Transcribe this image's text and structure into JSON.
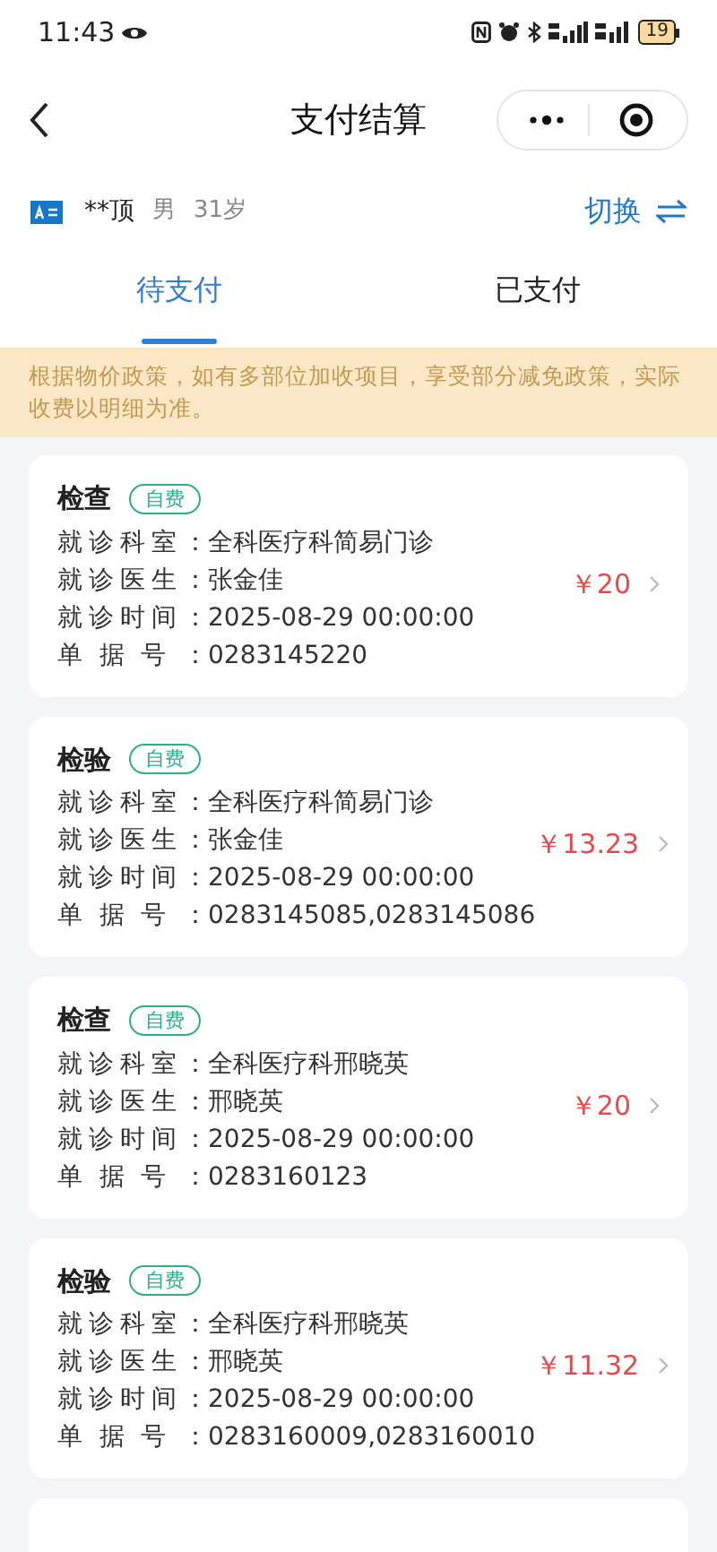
{
  "status_bar": {
    "time": "11:43",
    "battery": "19"
  },
  "nav": {
    "title": "支付结算"
  },
  "patient": {
    "name": "**顶",
    "gender": "男",
    "age": "31岁",
    "switch_label": "切换"
  },
  "tabs": [
    {
      "label": "待支付",
      "selected": true
    },
    {
      "label": "已支付",
      "selected": false
    }
  ],
  "notice": "根据物价政策，如有多部位加收项目，享受部分减免政策，实际收费以明细为准。",
  "bills": [
    {
      "type": "检查",
      "tag": "自费",
      "fields": [
        {
          "label": "就诊科室：",
          "value": "全科医疗科简易门诊"
        },
        {
          "label": "就诊医生：",
          "value": "张金佳"
        },
        {
          "label": "就诊时间：",
          "value": "2025-08-29 00:00:00"
        },
        {
          "label": "单据号：",
          "value": "0283145220"
        }
      ],
      "amount": "￥20"
    },
    {
      "type": "检验",
      "tag": "自费",
      "fields": [
        {
          "label": "就诊科室：",
          "value": "全科医疗科简易门诊"
        },
        {
          "label": "就诊医生：",
          "value": "张金佳"
        },
        {
          "label": "就诊时间：",
          "value": "2025-08-29 00:00:00"
        },
        {
          "label": "单据号：",
          "value": "0283145085,0283145086"
        }
      ],
      "amount": "￥13.23"
    },
    {
      "type": "检查",
      "tag": "自费",
      "fields": [
        {
          "label": "就诊科室：",
          "value": "全科医疗科邢晓英"
        },
        {
          "label": "就诊医生：",
          "value": "邢晓英"
        },
        {
          "label": "就诊时间：",
          "value": "2025-08-29 00:00:00"
        },
        {
          "label": "单据号：",
          "value": "0283160123"
        }
      ],
      "amount": "￥20"
    },
    {
      "type": "检验",
      "tag": "自费",
      "fields": [
        {
          "label": "就诊科室：",
          "value": "全科医疗科邢晓英"
        },
        {
          "label": "就诊医生：",
          "value": "邢晓英"
        },
        {
          "label": "就诊时间：",
          "value": "2025-08-29 00:00:00"
        },
        {
          "label": "单据号：",
          "value": "0283160009,0283160010"
        }
      ],
      "amount": "￥11.32"
    }
  ]
}
